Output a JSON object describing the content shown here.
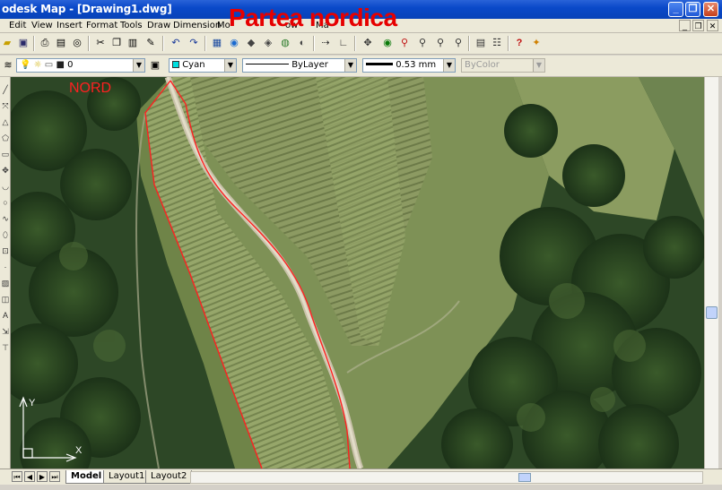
{
  "window": {
    "title": "odesk Map - [Drawing1.dwg]",
    "controls": {
      "minimize": "_",
      "maximize": "❐",
      "close": "✕"
    }
  },
  "overlay_title": "Partea nordica",
  "menu": {
    "items": [
      "Edit",
      "View",
      "Insert",
      "Format",
      "Tools",
      "Draw",
      "Dimension",
      "Mo",
      "ow",
      "Ma"
    ],
    "mdi_controls": {
      "minimize": "_",
      "restore": "❐",
      "close": "✕"
    }
  },
  "toolbar_properties": {
    "layer_value": "0",
    "color_value": "Cyan",
    "linetype_value": "ByLayer",
    "lineweight_value": "0.53 mm",
    "plotstyle_value": "ByColor"
  },
  "drawing": {
    "nord_label": "NORD",
    "ucs_x": "X",
    "ucs_y": "Y",
    "boundary_color": "#ff2020"
  },
  "layout_tabs": {
    "tabs": [
      "Model",
      "Layout1",
      "Layout2"
    ],
    "active": "Model"
  },
  "icons": {
    "standard": [
      "open-icon",
      "save-icon",
      "print-icon",
      "preview-icon",
      "publish-icon",
      "cut-icon",
      "copy-icon",
      "paste-icon",
      "matchprop-icon",
      "undo-icon",
      "redo-icon"
    ],
    "map": [
      "map-1-icon",
      "map-2-icon",
      "map-3-icon",
      "map-4-icon",
      "map-5-icon",
      "map-6-icon",
      "map-7-icon",
      "map-8-icon",
      "eye-icon",
      "zoom-realtime-icon",
      "zoom-window-icon",
      "zoom-prev-icon",
      "properties-icon",
      "designcenter-icon",
      "help-icon",
      "assistant-icon"
    ]
  }
}
